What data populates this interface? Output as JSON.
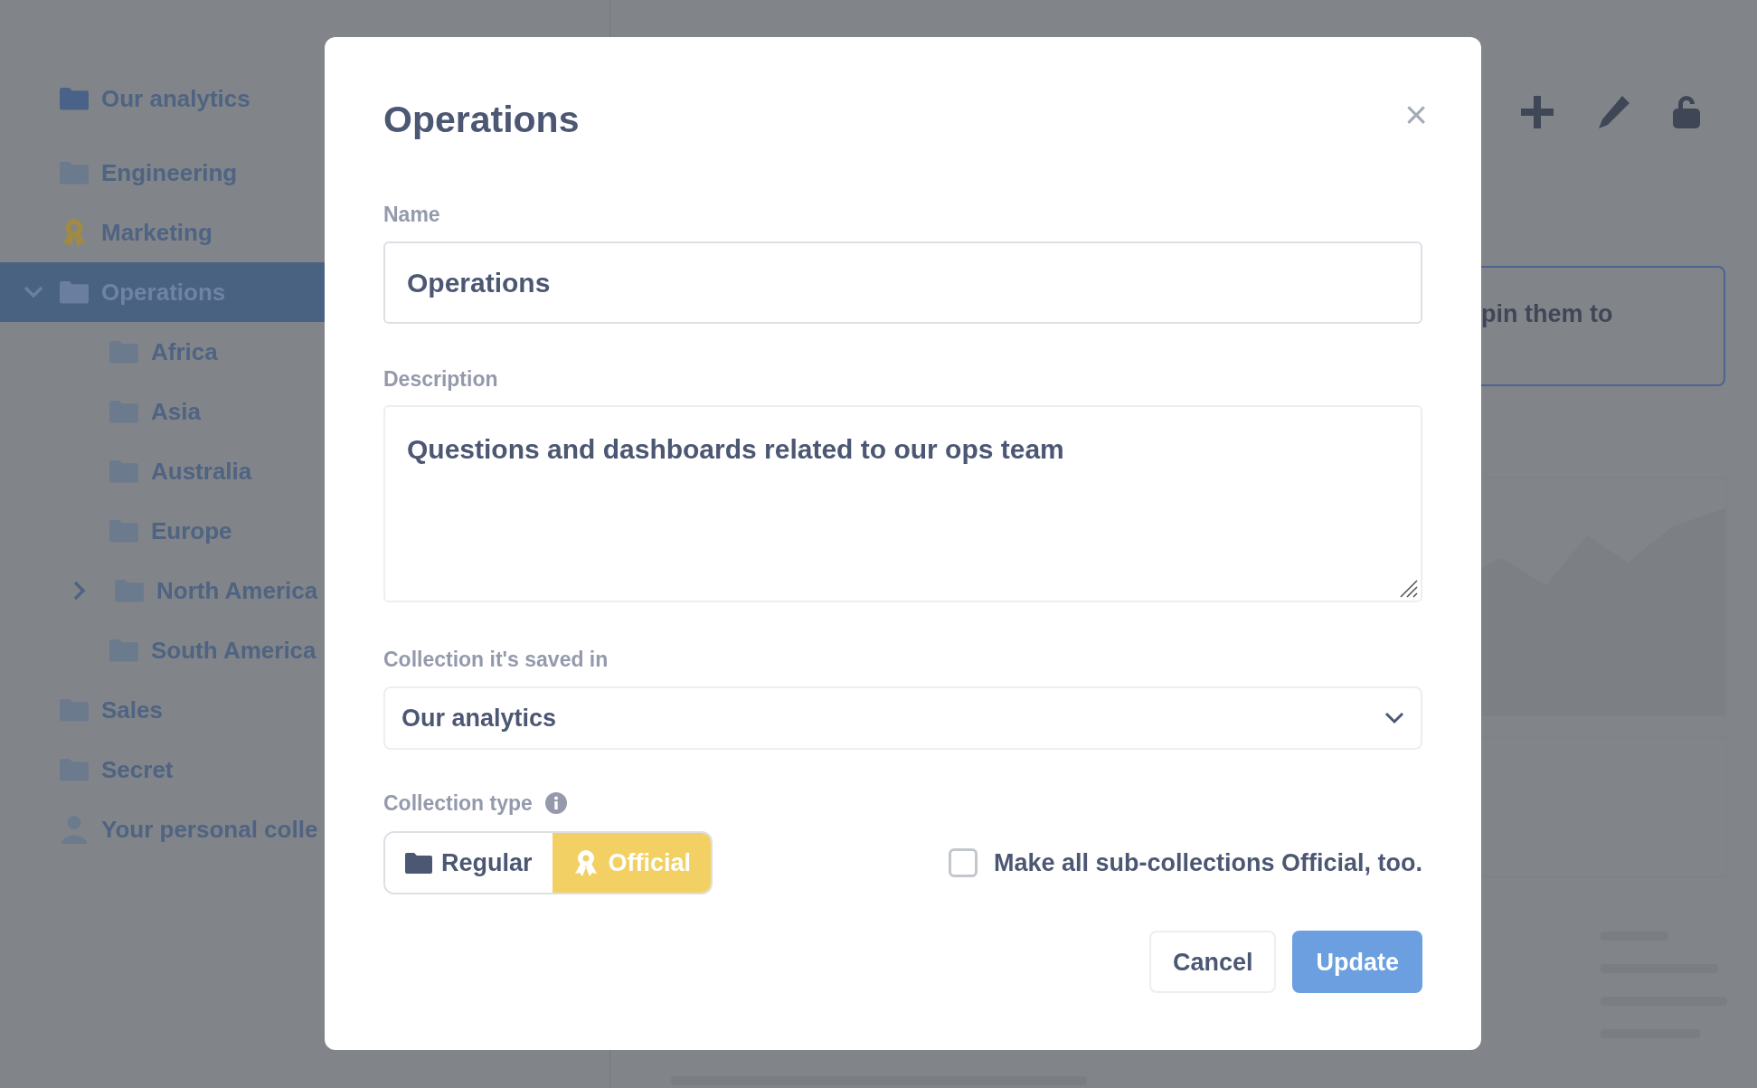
{
  "sidebar": {
    "items": [
      {
        "label": "Our analytics",
        "kind": "folder",
        "selected": false
      },
      {
        "label": "Engineering",
        "kind": "folder",
        "selected": false
      },
      {
        "label": "Marketing",
        "kind": "badge",
        "selected": false
      },
      {
        "label": "Operations",
        "kind": "folder",
        "selected": true,
        "expanded": true,
        "children": [
          {
            "label": "Africa",
            "kind": "folder",
            "selected": false
          },
          {
            "label": "Asia",
            "kind": "folder",
            "selected": false
          },
          {
            "label": "Australia",
            "kind": "folder",
            "selected": false
          },
          {
            "label": "Europe",
            "kind": "folder",
            "selected": false
          },
          {
            "label": "North America",
            "kind": "folder",
            "selected": false,
            "expanded": false
          },
          {
            "label": "South America",
            "kind": "folder",
            "selected": false
          }
        ]
      },
      {
        "label": "Sales",
        "kind": "folder",
        "selected": false
      },
      {
        "label": "Secret",
        "kind": "folder",
        "selected": false
      },
      {
        "label": "Your personal colle",
        "kind": "person",
        "selected": false
      }
    ]
  },
  "background": {
    "banner": "pin them to"
  },
  "dialog": {
    "title": "Operations",
    "close": "×",
    "name": {
      "label": "Name",
      "value": "Operations"
    },
    "description": {
      "label": "Description",
      "value": "Questions and dashboards related to our ops team"
    },
    "parent": {
      "label": "Collection it's saved in",
      "value": "Our analytics"
    },
    "type": {
      "label": "Collection type",
      "options": [
        {
          "label": "Regular",
          "kind": "folder",
          "selected": false
        },
        {
          "label": "Official",
          "kind": "badge",
          "selected": true
        }
      ]
    },
    "subcollections": {
      "label": "Make all sub-collections Official, too.",
      "checked": false
    },
    "buttons": [
      {
        "label": "Cancel",
        "kind": "secondary"
      },
      {
        "label": "Update",
        "kind": "primary"
      }
    ]
  }
}
